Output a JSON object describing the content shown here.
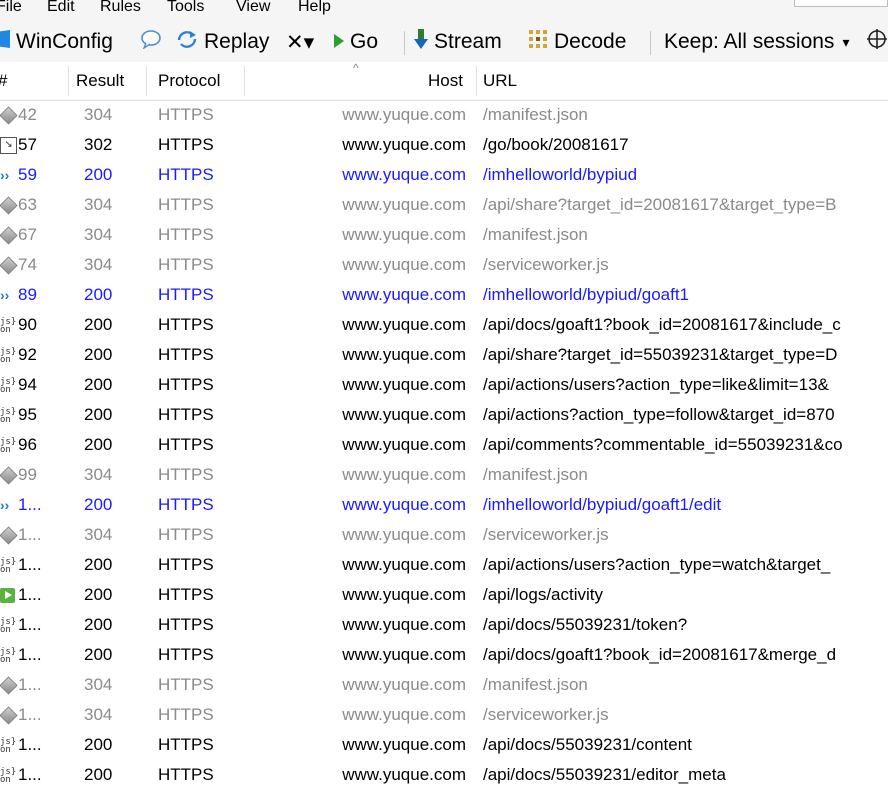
{
  "menu": [
    "File",
    "Edit",
    "Rules",
    "Tools",
    "View",
    "Help"
  ],
  "toolbar": {
    "winconfig": "WinConfig",
    "replay": "Replay",
    "remove": "✕▾",
    "go": "Go",
    "stream": "Stream",
    "decode": "Decode",
    "keep": "Keep: All sessions",
    "keep_caret": "▾"
  },
  "columns": {
    "num": "#",
    "result": "Result",
    "protocol": "Protocol",
    "host": "Host",
    "url": "URL",
    "sort_caret": "^"
  },
  "sessions": [
    {
      "icon": "cache",
      "num": "42",
      "result": "304",
      "protocol": "HTTPS",
      "host": "www.yuque.com",
      "url": "/manifest.json",
      "style": "gray"
    },
    {
      "icon": "redirect",
      "num": "57",
      "result": "302",
      "protocol": "HTTPS",
      "host": "www.yuque.com",
      "url": "/go/book/20081617",
      "style": "black"
    },
    {
      "icon": "page",
      "num": "59",
      "result": "200",
      "protocol": "HTTPS",
      "host": "www.yuque.com",
      "url": "/imhelloworld/bypiud",
      "style": "blue"
    },
    {
      "icon": "cache",
      "num": "63",
      "result": "304",
      "protocol": "HTTPS",
      "host": "www.yuque.com",
      "url": "/api/share?target_id=20081617&target_type=B",
      "style": "gray"
    },
    {
      "icon": "cache",
      "num": "67",
      "result": "304",
      "protocol": "HTTPS",
      "host": "www.yuque.com",
      "url": "/manifest.json",
      "style": "gray"
    },
    {
      "icon": "cache",
      "num": "74",
      "result": "304",
      "protocol": "HTTPS",
      "host": "www.yuque.com",
      "url": "/serviceworker.js",
      "style": "gray"
    },
    {
      "icon": "page",
      "num": "89",
      "result": "200",
      "protocol": "HTTPS",
      "host": "www.yuque.com",
      "url": "/imhelloworld/bypiud/goaft1",
      "style": "blue"
    },
    {
      "icon": "js",
      "num": "90",
      "result": "200",
      "protocol": "HTTPS",
      "host": "www.yuque.com",
      "url": "/api/docs/goaft1?book_id=20081617&include_c",
      "style": "black"
    },
    {
      "icon": "js",
      "num": "92",
      "result": "200",
      "protocol": "HTTPS",
      "host": "www.yuque.com",
      "url": "/api/share?target_id=55039231&target_type=D",
      "style": "black"
    },
    {
      "icon": "js",
      "num": "94",
      "result": "200",
      "protocol": "HTTPS",
      "host": "www.yuque.com",
      "url": "/api/actions/users?action_type=like&limit=13&",
      "style": "black"
    },
    {
      "icon": "js",
      "num": "95",
      "result": "200",
      "protocol": "HTTPS",
      "host": "www.yuque.com",
      "url": "/api/actions?action_type=follow&target_id=870",
      "style": "black"
    },
    {
      "icon": "js",
      "num": "96",
      "result": "200",
      "protocol": "HTTPS",
      "host": "www.yuque.com",
      "url": "/api/comments?commentable_id=55039231&co",
      "style": "black"
    },
    {
      "icon": "cache",
      "num": "99",
      "result": "304",
      "protocol": "HTTPS",
      "host": "www.yuque.com",
      "url": "/manifest.json",
      "style": "gray"
    },
    {
      "icon": "page",
      "num": "1...",
      "result": "200",
      "protocol": "HTTPS",
      "host": "www.yuque.com",
      "url": "/imhelloworld/bypiud/goaft1/edit",
      "style": "blue"
    },
    {
      "icon": "cache",
      "num": "1...",
      "result": "304",
      "protocol": "HTTPS",
      "host": "www.yuque.com",
      "url": "/serviceworker.js",
      "style": "gray"
    },
    {
      "icon": "js",
      "num": "1...",
      "result": "200",
      "protocol": "HTTPS",
      "host": "www.yuque.com",
      "url": "/api/actions/users?action_type=watch&target_",
      "style": "black"
    },
    {
      "icon": "post",
      "num": "1...",
      "result": "200",
      "protocol": "HTTPS",
      "host": "www.yuque.com",
      "url": "/api/logs/activity",
      "style": "black"
    },
    {
      "icon": "js",
      "num": "1...",
      "result": "200",
      "protocol": "HTTPS",
      "host": "www.yuque.com",
      "url": "/api/docs/55039231/token?",
      "style": "black"
    },
    {
      "icon": "js",
      "num": "1...",
      "result": "200",
      "protocol": "HTTPS",
      "host": "www.yuque.com",
      "url": "/api/docs/goaft1?book_id=20081617&merge_d",
      "style": "black"
    },
    {
      "icon": "cache",
      "num": "1...",
      "result": "304",
      "protocol": "HTTPS",
      "host": "www.yuque.com",
      "url": "/manifest.json",
      "style": "gray"
    },
    {
      "icon": "cache",
      "num": "1...",
      "result": "304",
      "protocol": "HTTPS",
      "host": "www.yuque.com",
      "url": "/serviceworker.js",
      "style": "gray"
    },
    {
      "icon": "js",
      "num": "1...",
      "result": "200",
      "protocol": "HTTPS",
      "host": "www.yuque.com",
      "url": "/api/docs/55039231/content",
      "style": "black"
    },
    {
      "icon": "js",
      "num": "1...",
      "result": "200",
      "protocol": "HTTPS",
      "host": "www.yuque.com",
      "url": "/api/docs/55039231/editor_meta",
      "style": "black"
    }
  ]
}
